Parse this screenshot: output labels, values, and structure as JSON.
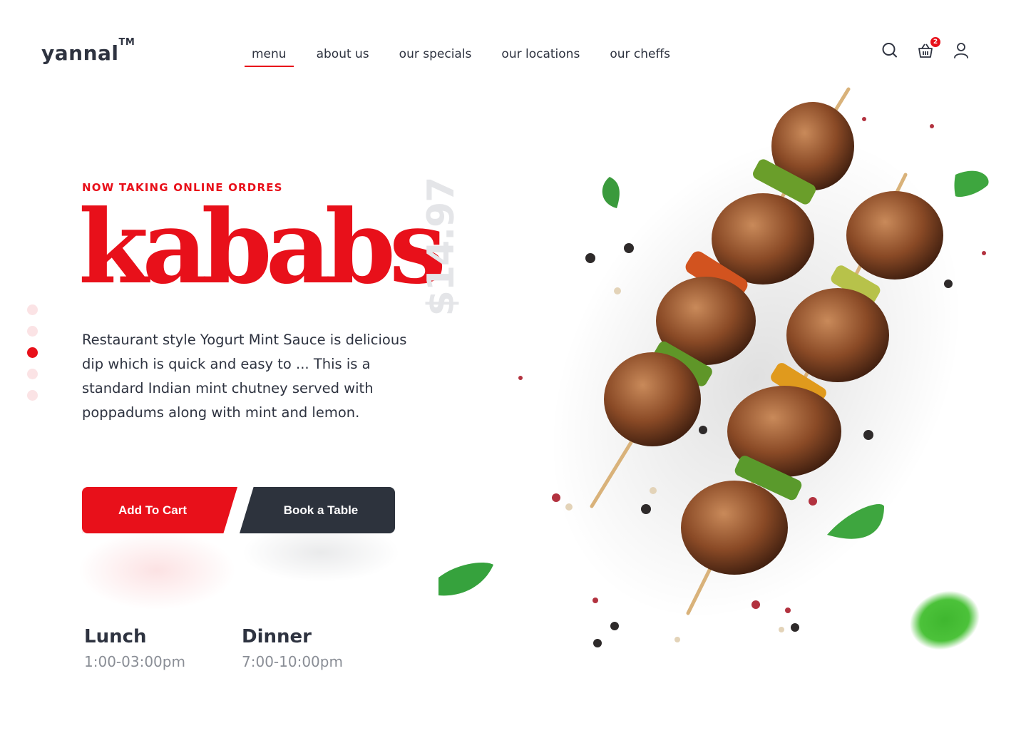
{
  "brand": {
    "name": "yannal",
    "trademark": "TM"
  },
  "nav": [
    {
      "label": "menu",
      "active": true
    },
    {
      "label": "about us",
      "active": false
    },
    {
      "label": "our specials",
      "active": false
    },
    {
      "label": "our locations",
      "active": false
    },
    {
      "label": "our cheffs",
      "active": false
    }
  ],
  "header_icons": {
    "search": "search-icon",
    "cart": "basket-icon",
    "cart_count": "2",
    "user": "user-icon"
  },
  "hero": {
    "eyebrow": "NOW TAKING ONLINE ORDRES",
    "title": "kababs",
    "price": "$14.97",
    "description": "Restaurant style Yogurt Mint Sauce is delicious dip which is quick and easy to ... This is a standard Indian mint chutney served with poppadums along with mint and lemon."
  },
  "slider": {
    "count": 5,
    "active_index": 3
  },
  "buttons": {
    "add_to_cart": "Add To Cart",
    "book_table": "Book a Table"
  },
  "hours": {
    "lunch": {
      "label": "Lunch",
      "time": "1:00-03:00pm"
    },
    "dinner": {
      "label": "Dinner",
      "time": "7:00-10:00pm"
    }
  },
  "colors": {
    "accent": "#e8101a",
    "dark": "#2d333d",
    "text": "#2e3340",
    "muted": "#8a8e96"
  }
}
